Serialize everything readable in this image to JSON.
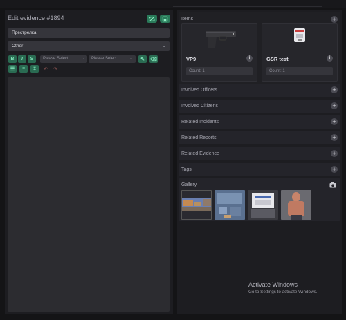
{
  "edit": {
    "title": "Edit evidence #1894",
    "name_value": "Престрелка",
    "type_value": "Other",
    "editor_content": "..."
  },
  "toolbar": {
    "select1": "Please Select",
    "select2": "Please Select"
  },
  "items": {
    "title": "Items",
    "cards": [
      {
        "name": "VP9",
        "count_placeholder": "Count: 1"
      },
      {
        "name": "GSR test",
        "count_placeholder": "Count: 1"
      }
    ]
  },
  "sections": {
    "involved_officers": "Involved Officers",
    "involved_citizens": "Involved Citizens",
    "related_incidents": "Related Incidents",
    "related_reports": "Related Reports",
    "related_evidence": "Related Evidence",
    "tags": "Tags",
    "gallery": "Gallery"
  },
  "watermark": {
    "title": "Activate Windows",
    "subtitle": "Go to Settings to activate Windows."
  },
  "colors": {
    "accent": "#2a7a5a",
    "panel": "#1d1d21",
    "field": "#35353b"
  }
}
